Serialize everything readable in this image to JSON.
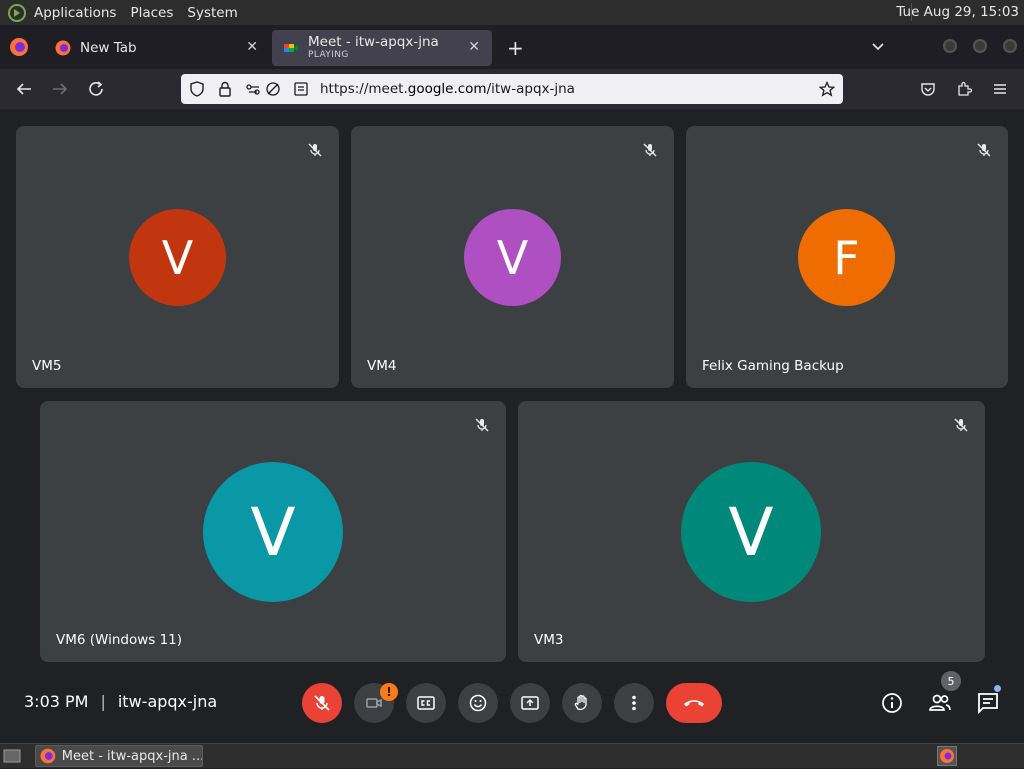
{
  "system_panel": {
    "menus": [
      "Applications",
      "Places",
      "System"
    ],
    "clock": "Tue Aug 29, 15:03"
  },
  "browser": {
    "tabs": [
      {
        "title": "New Tab",
        "subtitle": ""
      },
      {
        "title": "Meet - itw-apqx-jna",
        "subtitle": "PLAYING"
      }
    ],
    "url_prefix": "https://meet.",
    "url_domain": "google.com",
    "url_path": "/itw-apqx-jna"
  },
  "meet": {
    "participants": [
      {
        "name": "VM5",
        "initial": "V",
        "color": "#c1360f"
      },
      {
        "name": "VM4",
        "initial": "V",
        "color": "#ae4fc2"
      },
      {
        "name": "Felix Gaming Backup",
        "initial": "F",
        "color": "#ef6c00"
      },
      {
        "name": "VM6 (Windows 11)",
        "initial": "V",
        "color": "#0a97a6"
      },
      {
        "name": "VM3",
        "initial": "V",
        "color": "#00897b"
      }
    ],
    "time": "3:03 PM",
    "separator": "|",
    "meeting_code": "itw-apqx-jna",
    "camera_warning": "!",
    "people_count": "5"
  },
  "taskbar": {
    "window_title": "Meet - itw-apqx-jna ..."
  },
  "colors": {
    "accent_red": "#ea4335",
    "tile_bg": "#3c4043",
    "page_bg": "#202124"
  }
}
